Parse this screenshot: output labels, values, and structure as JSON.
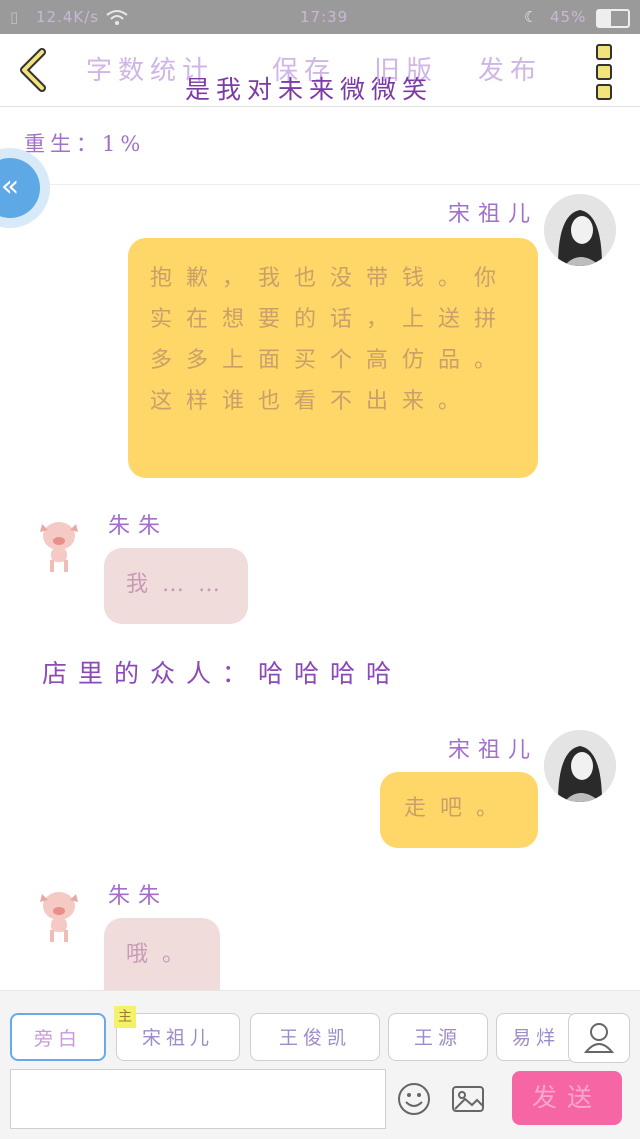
{
  "status": {
    "speed": "12.4K/s",
    "time": "17:39",
    "battery": "45%"
  },
  "header": {
    "menu": [
      "字数统计",
      "保存",
      "旧版",
      "发布"
    ],
    "subtitle": "是我对未来微微笑"
  },
  "rebirth_label": "重生：1%",
  "messages": [
    {
      "speaker": "宋祖儿",
      "side": "right",
      "text": "抱歉，我也没带钱。你实在想要的话，上送拼多多上面买个高仿品。这样谁也看不出来。"
    },
    {
      "speaker": "朱朱",
      "side": "left",
      "text": "我……"
    },
    {
      "speaker": "店里的众人：哈哈哈哈",
      "side": "center",
      "text": ""
    },
    {
      "speaker": "宋祖儿",
      "side": "right",
      "text": "走吧。"
    },
    {
      "speaker": "朱朱",
      "side": "left",
      "text": "哦。"
    }
  ],
  "role_chips": [
    "旁白",
    "宋祖儿",
    "王俊凯",
    "王源",
    "易烊"
  ],
  "main_tag": "主",
  "send_label": "发送",
  "icons": [
    "back-icon",
    "more-icon",
    "collapse-icon",
    "user-icon",
    "emoji-icon",
    "image-icon",
    "wifi-icon",
    "moon-icon",
    "battery-icon"
  ]
}
